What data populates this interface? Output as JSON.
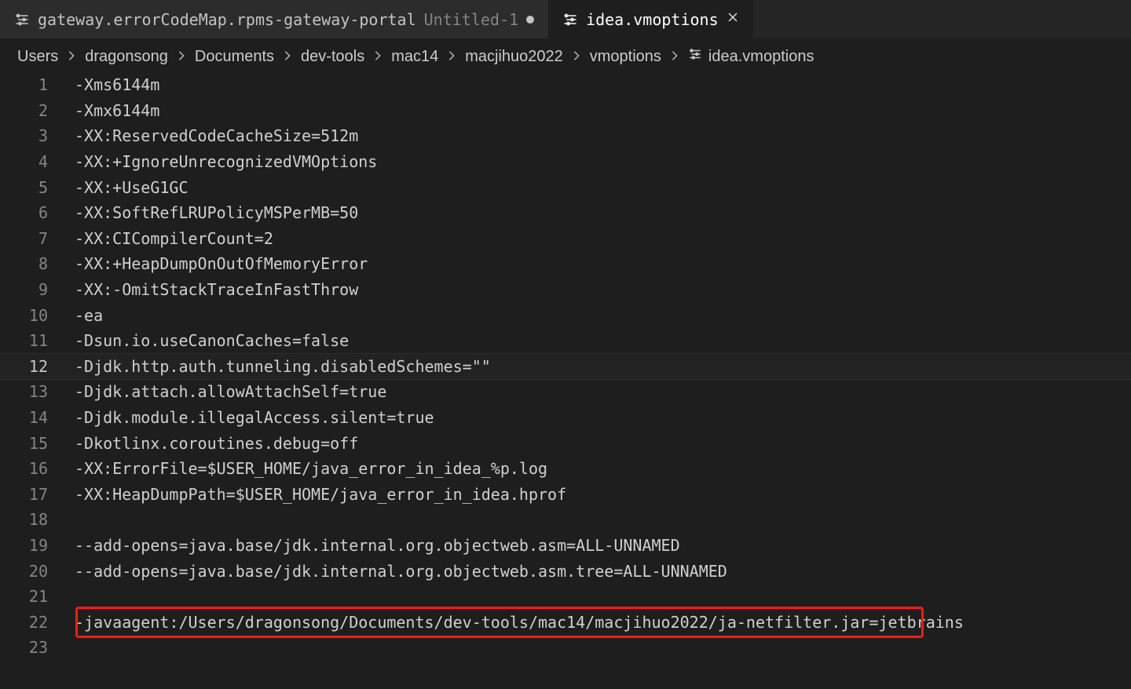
{
  "tabs": {
    "inactive": {
      "title_main": "gateway.errorCodeMap.rpms-gateway-portal",
      "title_dim": "Untitled-1"
    },
    "active": {
      "title": "idea.vmoptions"
    }
  },
  "breadcrumb": {
    "parts": [
      "Users",
      "dragonsong",
      "Documents",
      "dev-tools",
      "mac14",
      "macjihuo2022",
      "vmoptions"
    ],
    "leaf": "idea.vmoptions"
  },
  "editor": {
    "current_line": 12,
    "highlight_line": 22,
    "lines": [
      "-Xms6144m",
      "-Xmx6144m",
      "-XX:ReservedCodeCacheSize=512m",
      "-XX:+IgnoreUnrecognizedVMOptions",
      "-XX:+UseG1GC",
      "-XX:SoftRefLRUPolicyMSPerMB=50",
      "-XX:CICompilerCount=2",
      "-XX:+HeapDumpOnOutOfMemoryError",
      "-XX:-OmitStackTraceInFastThrow",
      "-ea",
      "-Dsun.io.useCanonCaches=false",
      "-Djdk.http.auth.tunneling.disabledSchemes=\"\"",
      "-Djdk.attach.allowAttachSelf=true",
      "-Djdk.module.illegalAccess.silent=true",
      "-Dkotlinx.coroutines.debug=off",
      "-XX:ErrorFile=$USER_HOME/java_error_in_idea_%p.log",
      "-XX:HeapDumpPath=$USER_HOME/java_error_in_idea.hprof",
      "",
      "--add-opens=java.base/jdk.internal.org.objectweb.asm=ALL-UNNAMED",
      "--add-opens=java.base/jdk.internal.org.objectweb.asm.tree=ALL-UNNAMED",
      "",
      "-javaagent:/Users/dragonsong/Documents/dev-tools/mac14/macjihuo2022/ja-netfilter.jar=jetbrains",
      ""
    ]
  },
  "colors": {
    "highlight_border": "#ff1a1a"
  }
}
